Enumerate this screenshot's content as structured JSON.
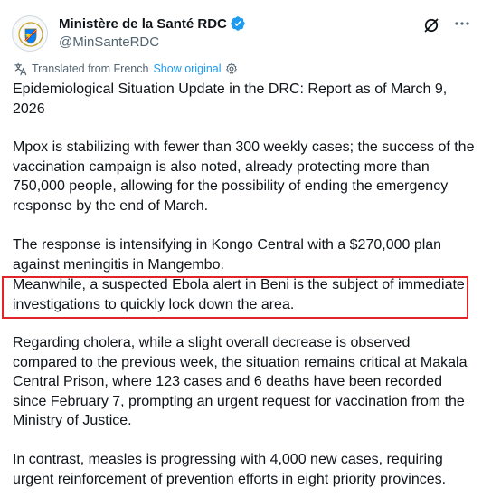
{
  "account": {
    "display_name": "Ministère de la Santé RDC",
    "handle": "@MinSanteRDC",
    "avatar_icon": "coat-of-arms-icon"
  },
  "translation": {
    "note": "Translated from French",
    "show_original": "Show original"
  },
  "post": {
    "p1": "Epidemiological Situation Update in the DRC: Report as of March 9, 2026",
    "p2": "Mpox is stabilizing with fewer than 300 weekly cases; the success of the vaccination campaign is also noted, already protecting more than 750,000 people, allowing for the possibility of ending the emergency response by the end of March.",
    "p3": "The response is intensifying in Kongo Central with a $270,000 plan against meningitis in Mangembo.",
    "p3b": "Meanwhile, a suspected Ebola alert in Beni is the subject of immediate investigations to quickly lock down the area.",
    "p4": "Regarding cholera, while a slight overall decrease is observed compared to the previous week, the situation remains critical at Makala Central Prison, where 123 cases and 6 deaths have been recorded since February 7, prompting an urgent request for vaccination from the Ministry of Justice.",
    "p5": "In contrast, measles is progressing with 4,000 new cases, requiring urgent reinforcement of prevention efforts in eight priority provinces."
  },
  "colors": {
    "accent": "#1d9bf0",
    "highlight_border": "#e0242a",
    "secondary_text": "#536471"
  }
}
